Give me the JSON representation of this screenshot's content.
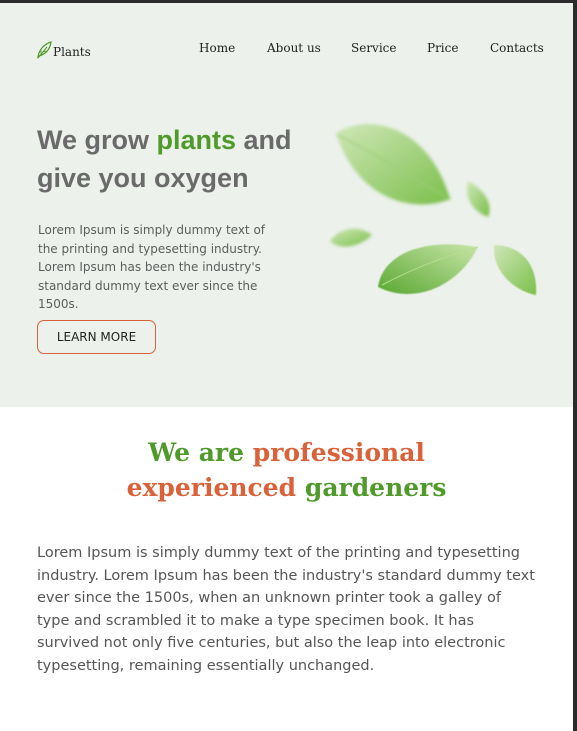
{
  "header": {
    "logo_text": "Plants",
    "nav": [
      "Home",
      "About us",
      "Service",
      "Price",
      "Contacts"
    ]
  },
  "hero": {
    "title_part1": "We grow ",
    "title_highlight": "plants",
    "title_part2": " and give you oxygen",
    "description": "Lorem Ipsum is simply dummy text of the printing and typesetting industry. Lorem Ipsum has been the industry's standard dummy text ever since the 1500s.",
    "cta_label": "LEARN MORE"
  },
  "about": {
    "title_a": "We are ",
    "title_b": "professional",
    "title_c": "experienced",
    "title_d": " gardeners",
    "body": "Lorem Ipsum is simply dummy text of the printing and typesetting industry. Lorem Ipsum has been the industry's standard dummy text ever since the 1500s, when an unknown printer took a galley of type and scrambled it to make a type specimen book. It has survived not only five centuries, but also the leap into electronic typesetting, remaining essentially unchanged."
  },
  "colors": {
    "hero_bg": "#ecf1ec",
    "accent_green": "#4f9a2a",
    "accent_orange": "#d9623a",
    "text_gray": "#6a6a6a"
  },
  "icons": {
    "logo": "leaf-icon",
    "hero_art": "floating-leaves-illustration"
  }
}
